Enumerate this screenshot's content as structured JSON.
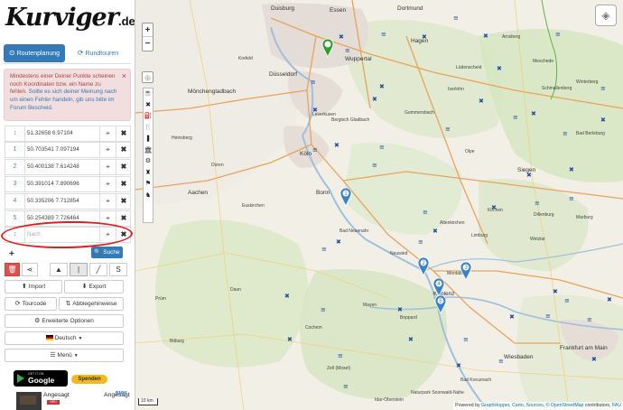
{
  "logo": {
    "text": "Kurviger",
    "tld": ".de"
  },
  "tabs": [
    {
      "label": "Routenplanung",
      "icon": "compass-icon"
    },
    {
      "label": "Rundtouren",
      "icon": "loop-icon"
    }
  ],
  "alert": {
    "text": "Mindestens einer Deiner Punkte scheinen noch Koordinaten bzw. ein Name zu fehlen.",
    "link_text": "Sollte es sich deiner Meinung nach um einen Fehler handeln, gib uns bitte im Forum Bescheid.",
    "close": "×"
  },
  "waypoints": [
    {
      "num": "↕",
      "coord": "51.32658 6.97104"
    },
    {
      "num": "1",
      "coord": "50.703541 7.097194"
    },
    {
      "num": "2",
      "coord": "50.400138 7.614248"
    },
    {
      "num": "3",
      "coord": "50.391014 7.890696"
    },
    {
      "num": "4",
      "coord": "50.335206 7.712854"
    },
    {
      "num": "5",
      "coord": "50.254389 7.726464"
    }
  ],
  "destination": {
    "num": "↕",
    "placeholder": "Nach"
  },
  "icons": {
    "locate": "⌖",
    "delete": "✖",
    "plus": "+",
    "search": "🔍",
    "trash": "🗑",
    "share": "⋖",
    "zoom_in": "+",
    "zoom_out": "−",
    "crosshair": "⊕",
    "layers": "◈"
  },
  "search_label": "Suche",
  "modes": [
    "▲",
    "|",
    "╱",
    "S"
  ],
  "buttons": {
    "import": "Import",
    "export": "Export",
    "tourcode": "Tourcode",
    "turn_hints": "Abbiegehinweise",
    "advanced": "Erweiterte Optionen",
    "language": "Deutsch",
    "menu": "Menü"
  },
  "store": {
    "small": "GET IT ON",
    "big": "Google Play"
  },
  "donate": "Spenden",
  "banners": {
    "label1": "Angesagt",
    "sub1": "NEU",
    "label2": "Angesagt",
    "sub2": "BMW"
  },
  "map": {
    "scale_text": "10 km",
    "attribution_prefix": "Powered by",
    "attribution_links": [
      "GraphHopper",
      "Carto",
      "Sources",
      "© OpenStreetMap"
    ],
    "attribution_mid": "contributors,",
    "attribution_last": "FAU",
    "poi_icons": [
      "☕",
      "✖",
      "⛽",
      "🍴",
      "❚",
      "🏛",
      "⚙",
      "♜",
      "⚑",
      "♞"
    ],
    "cities": [
      {
        "name": "Duisburg"
      },
      {
        "name": "Essen"
      },
      {
        "name": "Dortmund"
      },
      {
        "name": "Hagen"
      },
      {
        "name": "Düsseldorf"
      },
      {
        "name": "Wuppertal"
      },
      {
        "name": "Mönchengladbach"
      },
      {
        "name": "Köln"
      },
      {
        "name": "Bonn"
      },
      {
        "name": "Siegen"
      },
      {
        "name": "Koblenz"
      },
      {
        "name": "Wiesbaden"
      },
      {
        "name": "Frankfurt am Main"
      },
      {
        "name": "Krefeld"
      },
      {
        "name": "Bergisch Gladbach"
      },
      {
        "name": "Leverkusen"
      },
      {
        "name": "Aachen"
      },
      {
        "name": "Lüdenscheid"
      },
      {
        "name": "Gummersbach"
      },
      {
        "name": "Limburg"
      },
      {
        "name": "Neuwied"
      },
      {
        "name": "Boppard"
      },
      {
        "name": "Mayen"
      },
      {
        "name": "Montabaur"
      },
      {
        "name": "Winterberg"
      },
      {
        "name": "Schmallenberg"
      },
      {
        "name": "Bad Berleburg"
      },
      {
        "name": "Marburg"
      },
      {
        "name": "Wetzlar"
      },
      {
        "name": "Dillenburg"
      },
      {
        "name": "Altenkirchen"
      },
      {
        "name": "Cochem"
      },
      {
        "name": "Daun"
      },
      {
        "name": "Düren"
      },
      {
        "name": "Euskirchen"
      },
      {
        "name": "Prüm"
      },
      {
        "name": "Bitburg"
      },
      {
        "name": "Bad Neuenahr"
      },
      {
        "name": "Olpe"
      },
      {
        "name": "Arnsberg"
      },
      {
        "name": "Meschede"
      },
      {
        "name": "Iserlohn"
      },
      {
        "name": "Naturpark Soonwald-Nahe"
      },
      {
        "name": "Zell (Mosel)"
      },
      {
        "name": "Bad Kreuznach"
      },
      {
        "name": "Idar-Oberstein"
      },
      {
        "name": "Heinsberg"
      },
      {
        "name": "Kirchen"
      }
    ],
    "markers": [
      {
        "label": "1"
      },
      {
        "label": "2"
      },
      {
        "label": "3"
      },
      {
        "label": "4"
      },
      {
        "label": "5"
      }
    ]
  }
}
